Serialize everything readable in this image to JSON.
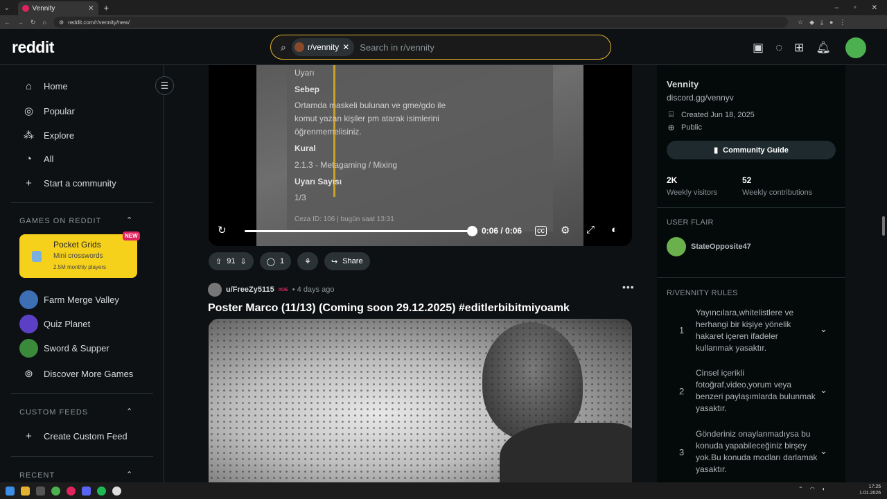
{
  "browser": {
    "tab_title": "Vennity",
    "url": "reddit.com/r/vennity/new/",
    "new_tab": "+"
  },
  "header": {
    "logo": "reddit",
    "search_chip": "r/vennity",
    "search_placeholder": "Search in r/vennity"
  },
  "sidebar": {
    "nav": [
      {
        "label": "Home",
        "icon": "home-icon"
      },
      {
        "label": "Popular",
        "icon": "popular-icon"
      },
      {
        "label": "Explore",
        "icon": "explore-icon"
      },
      {
        "label": "All",
        "icon": "all-icon"
      },
      {
        "label": "Start a community",
        "icon": "plus-icon"
      }
    ],
    "games_title": "GAMES ON REDDIT",
    "promo": {
      "title": "Pocket Grids",
      "subtitle": "Mini crosswords",
      "meta": "2.5M monthly players",
      "badge": "NEW"
    },
    "games": [
      "Farm Merge Valley",
      "Quiz Planet",
      "Sword & Supper",
      "Discover More Games"
    ],
    "custom_feeds_title": "CUSTOM FEEDS",
    "create_feed": "Create Custom Feed",
    "recent_title": "RECENT"
  },
  "video": {
    "lines": [
      {
        "text": "Uyarı",
        "bold": false
      },
      {
        "text": "Sebep",
        "bold": true
      },
      {
        "text": "Ortamda maskeli bulunan ve gme/gdo ile",
        "bold": false
      },
      {
        "text": "komut yazan kişiler pm atarak isimlerini",
        "bold": false
      },
      {
        "text": "öğrenmemelisiniz.",
        "bold": false
      },
      {
        "text": "Kural",
        "bold": true
      },
      {
        "text": "2.1.3 - Metagaming / Mixing",
        "bold": false
      },
      {
        "text": "Uyarı Sayısı",
        "bold": true
      },
      {
        "text": "1/3",
        "bold": false
      }
    ],
    "footer": "Ceza ID: 106 | bugün saat 13:31",
    "time": "0:06 / 0:06",
    "progress": 1.0
  },
  "post1_actions": {
    "votes": "91",
    "comments": "1",
    "share": "Share"
  },
  "post2": {
    "user": "u/FreeZy5115",
    "flair": "#OE",
    "time": "• 4 days ago",
    "title": "Poster Marco (11/13) (Coming soon 29.12.2025) #editlerbibitmiyoamk"
  },
  "rightbar": {
    "name": "Vennity",
    "desc": "discord.gg/vennyv",
    "created": "Created Jun 18, 2025",
    "visibility": "Public",
    "guide": "Community Guide",
    "stats": [
      {
        "value": "2K",
        "label": "Weekly visitors"
      },
      {
        "value": "52",
        "label": "Weekly contributions"
      }
    ],
    "user_flair_title": "USER FLAIR",
    "flair_name": "StateOpposite47",
    "rules_title": "R/VENNITY RULES",
    "rules": [
      {
        "n": "1",
        "text": "Yayıncılara,whitelistlere ve herhangi bir kişiye yönelik hakaret içeren ifadeler kullanmak yasaktır."
      },
      {
        "n": "2",
        "text": "Cinsel içerikli fotoğraf,video,yorum veya benzeri paylaşımlarda bulunmak yasaktır."
      },
      {
        "n": "3",
        "text": "Gönderiniz onaylanmadıysa bu konuda yapabileceğiniz birşey yok.Bu konuda modları darlamak yasaktır."
      }
    ]
  },
  "taskbar": {
    "time": "17:25",
    "date": "1.01.2026"
  },
  "colors": {
    "search_border": "#e3b22f",
    "promo_bg": "#f6d11c",
    "badge": "#e0245e"
  }
}
